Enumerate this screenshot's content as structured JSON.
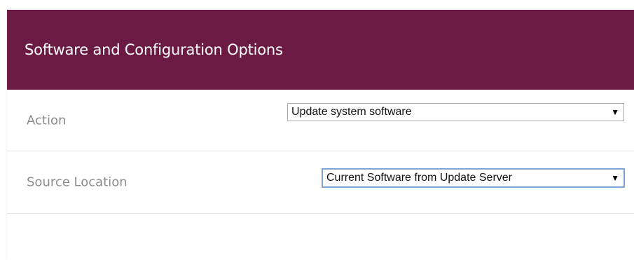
{
  "panel": {
    "title": "Software and Configuration Options"
  },
  "fields": [
    {
      "label": "Action",
      "selected": "Update system software"
    },
    {
      "label": "Source Location",
      "selected": "Current Software from Update Server"
    }
  ],
  "icons": {
    "dropdown_arrow": "▼"
  },
  "colors": {
    "header_bg": "#6b1a43",
    "header_text": "#ffffff",
    "label_text": "#8c8c8c",
    "focus_border": "#7fa4d6"
  }
}
